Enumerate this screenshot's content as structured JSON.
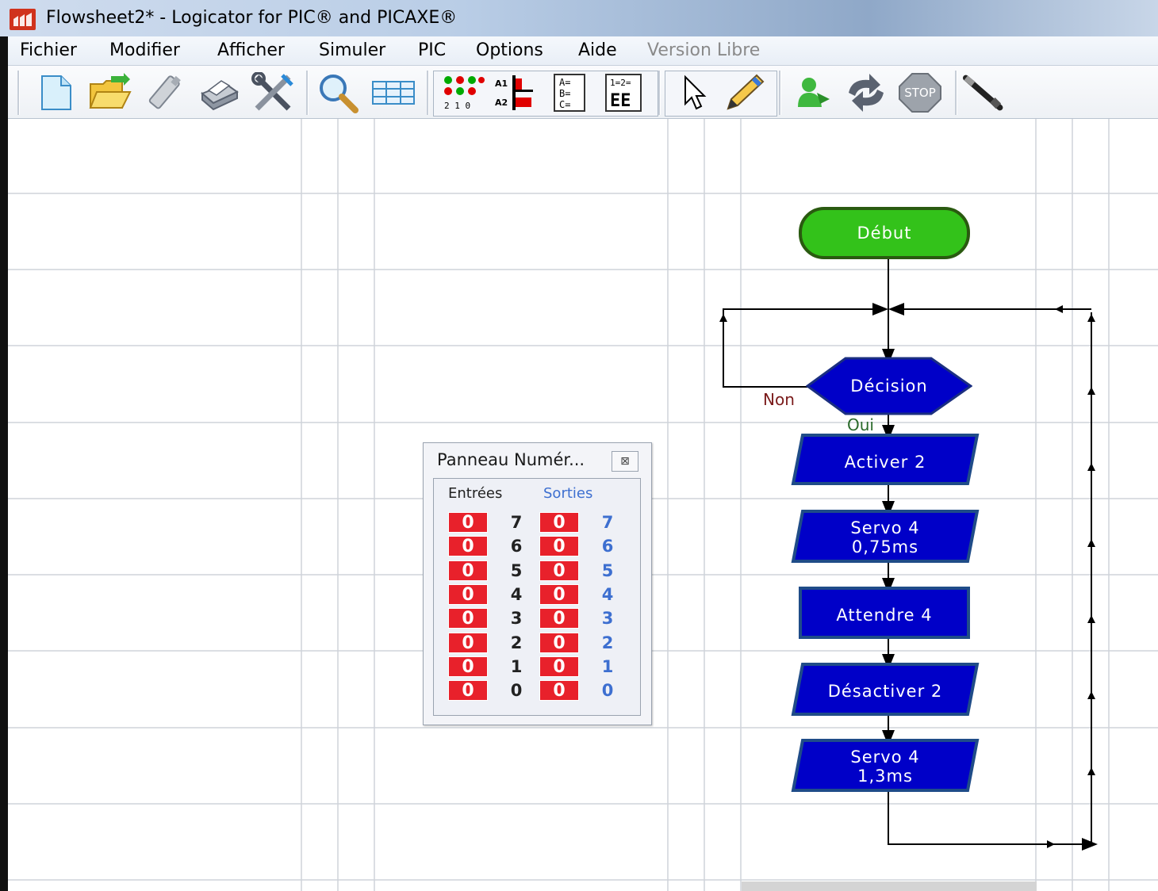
{
  "window": {
    "title": "Flowsheet2* - Logicator for PIC® and PICAXE®"
  },
  "menu": {
    "items": [
      {
        "label": "Fichier"
      },
      {
        "label": "Modifier"
      },
      {
        "label": "Afficher"
      },
      {
        "label": "Simuler"
      },
      {
        "label": "PIC"
      },
      {
        "label": "Options"
      },
      {
        "label": "Aide"
      },
      {
        "label": "Version Libre",
        "disabled": true
      }
    ]
  },
  "toolbar": {
    "buttons": [
      {
        "icon": "new-document-icon"
      },
      {
        "icon": "open-folder-icon"
      },
      {
        "icon": "usb-download-icon"
      },
      {
        "icon": "print-icon"
      },
      {
        "icon": "tools-icon"
      },
      {
        "icon": "zoom-icon"
      },
      {
        "icon": "table-icon"
      },
      {
        "icon": "digital-panel-icon"
      },
      {
        "icon": "analog-panel-icon"
      },
      {
        "icon": "variables-icon"
      },
      {
        "icon": "eeprom-icon"
      },
      {
        "icon": "select-pointer-icon"
      },
      {
        "icon": "pencil-icon"
      },
      {
        "icon": "run-simulation-icon"
      },
      {
        "icon": "refresh-icon"
      },
      {
        "icon": "stop-icon"
      },
      {
        "icon": "probe-icon"
      }
    ],
    "stop_label": "STOP",
    "digital_labels": "2 1 0",
    "analog_labels": [
      "A1",
      "A2"
    ],
    "variables_label": [
      "A=",
      "B=",
      "C="
    ],
    "eeprom_label": [
      "1=2=",
      "EE"
    ]
  },
  "flowchart": {
    "start": "Début",
    "decision": "Décision",
    "no_label": "Non",
    "yes_label": "Oui",
    "steps": [
      {
        "line1": "Activer 2",
        "line2": ""
      },
      {
        "line1": "Servo 4",
        "line2": "0,75ms"
      },
      {
        "line1": "Attendre 4",
        "line2": ""
      },
      {
        "line1": "Désactiver 2",
        "line2": ""
      },
      {
        "line1": "Servo 4",
        "line2": "1,3ms"
      }
    ]
  },
  "panel": {
    "title": "Panneau Numér...",
    "inputs_header": "Entrées",
    "outputs_header": "Sorties",
    "rows": [
      {
        "in_value": "0",
        "in_bit": "7",
        "out_value": "0",
        "out_bit": "7"
      },
      {
        "in_value": "0",
        "in_bit": "6",
        "out_value": "0",
        "out_bit": "6"
      },
      {
        "in_value": "0",
        "in_bit": "5",
        "out_value": "0",
        "out_bit": "5"
      },
      {
        "in_value": "0",
        "in_bit": "4",
        "out_value": "0",
        "out_bit": "4"
      },
      {
        "in_value": "0",
        "in_bit": "3",
        "out_value": "0",
        "out_bit": "3"
      },
      {
        "in_value": "0",
        "in_bit": "2",
        "out_value": "0",
        "out_bit": "2"
      },
      {
        "in_value": "0",
        "in_bit": "1",
        "out_value": "0",
        "out_bit": "1"
      },
      {
        "in_value": "0",
        "in_bit": "0",
        "out_value": "0",
        "out_bit": "0"
      }
    ]
  },
  "colors": {
    "start_fill": "#33c21a",
    "process_fill": "#0000c8",
    "bit_red": "#e8212b",
    "outputs_blue": "#3d6fd0"
  }
}
